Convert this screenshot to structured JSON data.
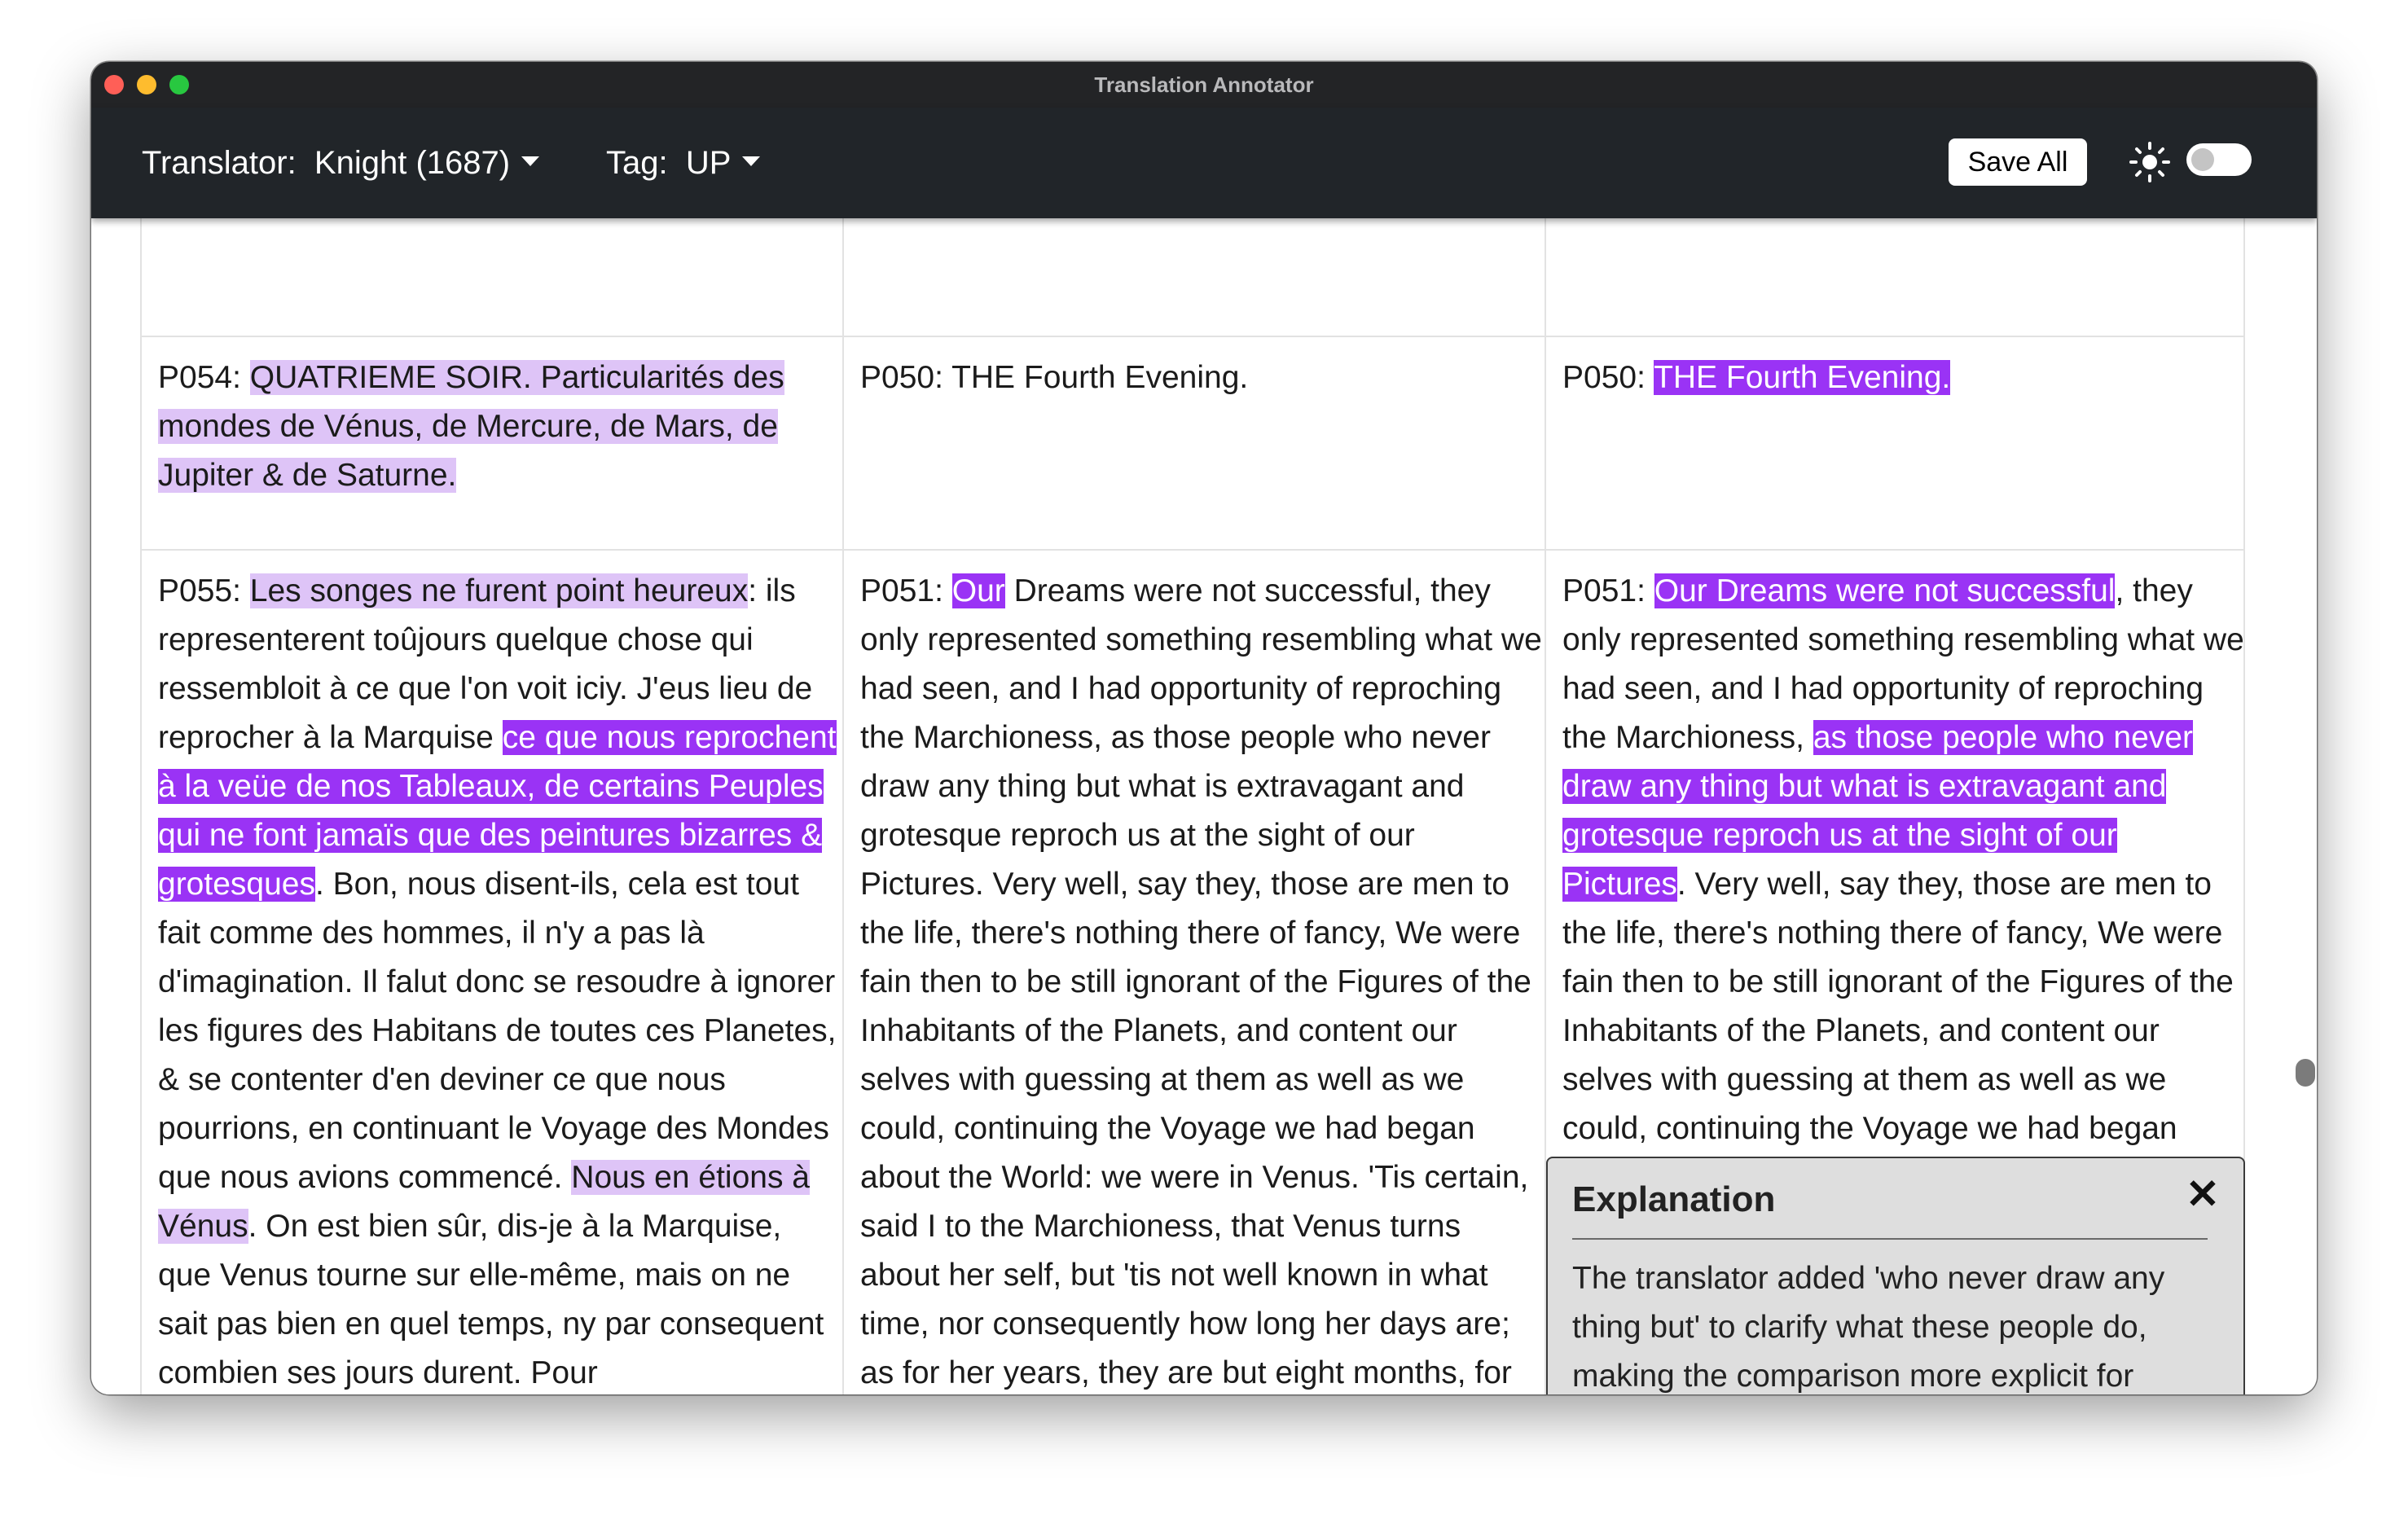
{
  "window": {
    "title": "Translation Annotator"
  },
  "toolbar": {
    "translator_label": "Translator:",
    "translator_value": "Knight (1687)",
    "tag_label": "Tag:",
    "tag_value": "UP",
    "save_label": "Save All",
    "theme_icon": "sun-icon",
    "theme_toggle_on": false
  },
  "colors": {
    "light_highlight": "#dec4f7",
    "dark_highlight": "#9a33f5",
    "toolbar_bg": "#212529"
  },
  "rows": [
    {
      "original": {
        "id": "P054:",
        "segments": [
          {
            "text": "QUATRIEME SOIR. Particularités des mondes de Vénus, de Mercure, de Mars, de Jupiter & de Saturne.",
            "hl": "light"
          }
        ]
      },
      "translation": {
        "id": "P050:",
        "segments": [
          {
            "text": "THE Fourth Evening.",
            "hl": null
          }
        ]
      },
      "annotated": {
        "id": "P050:",
        "segments": [
          {
            "text": "THE Fourth Evening.",
            "hl": "dark"
          }
        ]
      }
    },
    {
      "original": {
        "id": "P055:",
        "segments": [
          {
            "text": "Les songes ne furent point heureux",
            "hl": "light"
          },
          {
            "text": ": ils representerent toûjours quelque chose qui ressembloit à ce que l'on voit iciy. J'eus lieu de reprocher à la Marquise ",
            "hl": null
          },
          {
            "text": "ce que nous reprochent à la veüe de nos Tableaux, de certains Peuples qui ne font jamaïs que des peintures bizarres & grotesques",
            "hl": "dark"
          },
          {
            "text": ". Bon, nous disent-ils, cela est tout fait comme des hommes, il n'y a pas là d'imagination. Il falut donc se resoudre à ignorer les figures des Habitans de toutes ces Planetes, & se contenter d'en deviner ce que nous pourrions, en continuant le Voyage des Mondes que nous avions commencé. ",
            "hl": null
          },
          {
            "text": "Nous en étions à Vénus",
            "hl": "light"
          },
          {
            "text": ". On est bien sûr, dis-je à la Marquise, que Venus tourne sur elle-même, mais on ne sait pas bien en quel temps, ny par consequent combien ses jours durent. Pour",
            "hl": null
          }
        ]
      },
      "translation": {
        "id": "P051:",
        "segments": [
          {
            "text": "Our",
            "hl": "dark"
          },
          {
            "text": " Dreams were not successful, they only represented something resembling what we had seen, and I had opportunity of reproching the Marchioness, as those people who never draw any thing but what is extravagant and grotesque reproch us at the sight of our Pictures. Very well, say they, those are men to the life, there's nothing there of fancy, We were fain then to be still ignorant of the Figures of the Inhabitants of the Planets, and content our selves with guessing at them as well as we could, continuing the Voyage we had began about the World: we were in Venus. 'Tis certain, said I to the Marchioness, that Venus turns about her self, but 'tis not well known in what time, nor consequently how long her days are; as for her years, they are but eight months, for in so",
            "hl": null
          }
        ]
      },
      "annotated": {
        "id": "P051:",
        "segments": [
          {
            "text": "Our Dreams were not successful",
            "hl": "dark"
          },
          {
            "text": ", they only represented something resembling what we had seen, and I had opportunity of reproching the Marchioness, ",
            "hl": null
          },
          {
            "text": "as those people who never draw any thing but what is extravagant and grotesque reproch us at the sight of our Pictures",
            "hl": "dark"
          },
          {
            "text": ". Very well, say they, those are men to the life, there's nothing there of fancy, We were fain then to be still ignorant of the Figures of the Inhabitants of the Planets, and content our selves with guessing at them as well as we could, continuing the Voyage we had began about the World: we were in Venus. 'Tis certain, said I to the Marchioness, that Venus turns about her self, but 'tis not well known in what time, nor consequently how long her days are; as for her years, they are but eight months, for in so",
            "hl": null
          }
        ]
      }
    }
  ],
  "popup": {
    "title": "Explanation",
    "close_icon": "close-icon",
    "close_glyph": "✕",
    "body": "The translator added 'who never draw any thing but' to clarify what these people do, making the comparison more explicit for English readers than it was in the French original."
  }
}
